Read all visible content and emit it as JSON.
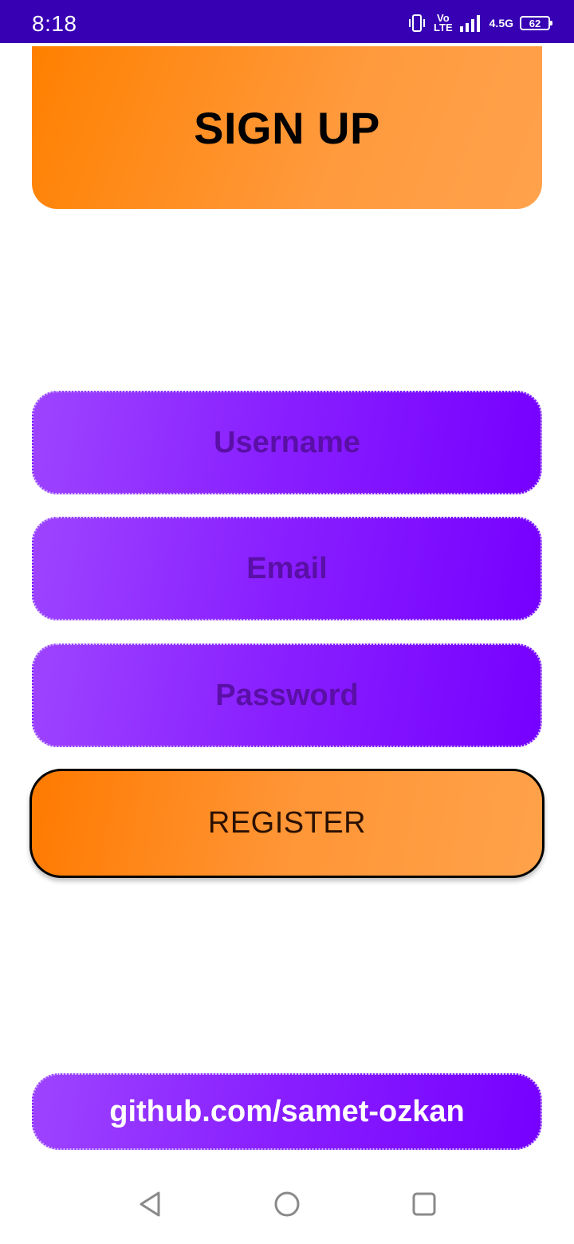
{
  "status_bar": {
    "time": "8:18",
    "network_top": "Vo",
    "network_bottom": "LTE",
    "signal_type": "4.5G",
    "battery": "62"
  },
  "header": {
    "title": "SIGN UP"
  },
  "form": {
    "username_placeholder": "Username",
    "email_placeholder": "Email",
    "password_placeholder": "Password",
    "register_label": "REGISTER"
  },
  "footer": {
    "github_link": "github.com/samet-ozkan"
  },
  "nav": {
    "icons": [
      "back-icon",
      "home-icon",
      "recents-icon"
    ]
  },
  "colors": {
    "status_bar": "#3700b3",
    "orange_accent": "#ff8000",
    "purple_accent": "#7600ff"
  }
}
